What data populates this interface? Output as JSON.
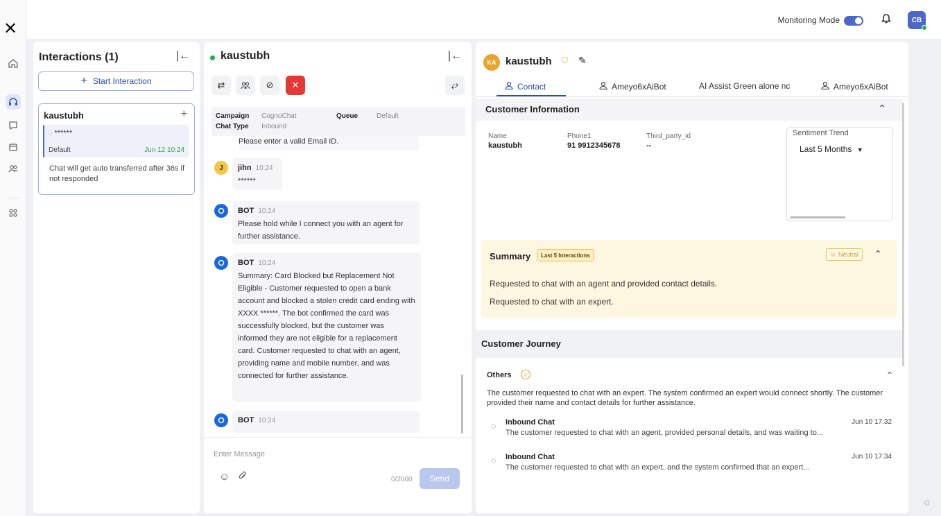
{
  "rail": {
    "logo": "✕",
    "items": [
      {
        "name": "home-icon"
      },
      {
        "name": "headset-icon",
        "active": true
      },
      {
        "name": "chat-icon"
      },
      {
        "name": "calendar-icon"
      },
      {
        "name": "contacts-icon"
      },
      {
        "name": "apps-icon"
      }
    ]
  },
  "topbar": {
    "monitoring_label": "Monitoring Mode",
    "user_initials": "CB"
  },
  "interactions": {
    "title": "Interactions (1)",
    "start_label": "Start Interaction",
    "card": {
      "name": "kaustubh",
      "preview": "******",
      "queue": "Default",
      "time": "Jun 12 10:24",
      "note": "Chat will get auto transferred after 36s if not responded"
    }
  },
  "chat": {
    "name": "kaustubh",
    "meta": {
      "campaign_label": "Campaign",
      "campaign_value": "CognoChat",
      "queue_label": "Queue",
      "queue_value": "Default",
      "chattype_label": "Chat Type",
      "chattype_value": "Inbound"
    },
    "first_text": "Please enter a valid Email ID.",
    "messages": [
      {
        "avatar": "J",
        "who": "jihn",
        "time": "10:24",
        "text": "******"
      },
      {
        "avatar": "",
        "who": "BOT",
        "time": "10:24",
        "text": "Please hold while I connect you with an agent for further assistance."
      },
      {
        "avatar": "",
        "who": "BOT",
        "time": "10:24",
        "text": "Summary: Card Blocked but Replacement Not Eligible - Customer requested to open a bank account and blocked a stolen credit card ending with XXXX ******. The bot confirmed the card was successfully blocked, but the customer was informed they are not eligible for a replacement card. Customer requested to chat with an agent, providing name and mobile number, and was connected for further assistance."
      },
      {
        "avatar": "",
        "who": "BOT",
        "time": "10:24",
        "text": ""
      }
    ],
    "composer": {
      "placeholder": "Enter Message",
      "count": "0/2000",
      "send_label": "Send"
    }
  },
  "contact": {
    "initials": "KA",
    "name": "kaustubh",
    "tabs": [
      {
        "label": "Contact",
        "icon": "user-icon",
        "active": true
      },
      {
        "label": "Ameyo6xAiBot",
        "icon": "user-icon"
      },
      {
        "label": "AI Assist Green alone nc",
        "icon": ""
      },
      {
        "label": "Ameyo6xAiBot",
        "icon": "user-icon"
      }
    ],
    "customer_info": {
      "title": "Customer Information",
      "fields": [
        {
          "label": "Name",
          "value": "kaustubh"
        },
        {
          "label": "Phone1",
          "value": "91 9912345678"
        },
        {
          "label": "Third_party_id",
          "value": "--"
        }
      ]
    },
    "sentiment": {
      "title": "Sentiment Trend",
      "selected": "Last 5 Months"
    },
    "summary": {
      "title": "Summary",
      "badge": "Last 5 Interactions",
      "sentiment": "Neutral",
      "lines": [
        "Requested to chat with an agent and provided contact details.",
        "Requested to chat with an expert."
      ]
    },
    "journey": {
      "title": "Customer Journey",
      "group": "Others",
      "group_text": "The customer requested to chat with an expert. The system confirmed an expert would connect shortly. The customer provided their name and contact details for further assistance.",
      "items": [
        {
          "title": "Inbound Chat",
          "date": "Jun 10 17:32",
          "desc": "The customer requested to chat with an agent, provided personal details, and was waiting to..."
        },
        {
          "title": "Inbound Chat",
          "date": "Jun 10 17:34",
          "desc": "The customer requested to chat with an expert, and the system confirmed that an expert..."
        }
      ]
    }
  },
  "colors": {
    "accent": "#2c4fa8",
    "online": "#2aa64a",
    "end_call": "#e53935",
    "summary_bg": "#fdf7e1"
  }
}
